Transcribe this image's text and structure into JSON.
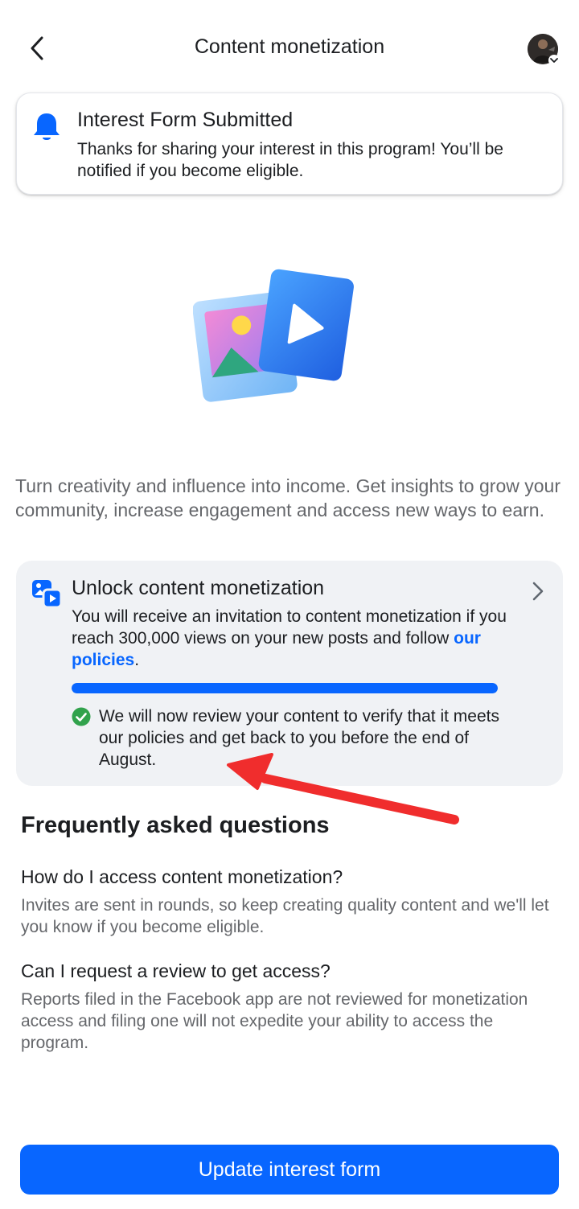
{
  "header": {
    "title": "Content monetization",
    "back_icon": "chevron-left-icon",
    "avatar_icon": "profile-avatar"
  },
  "notice": {
    "icon": "bell-icon",
    "title": "Interest Form Submitted",
    "body": "Thanks for sharing your interest in this program! You’ll be notified if you become eligible."
  },
  "hero": {
    "icon": "photo-video-illustration"
  },
  "intro": "Turn creativity and influence into income. Get insights to grow your community, increase engagement and access new ways to earn.",
  "card": {
    "icon": "photo-video-icon",
    "title": "Unlock content monetization",
    "body_before_link": "You will receive an invitation to content monetization if you reach 300,000 views on your new posts and follow ",
    "link_text": "our policies",
    "body_after_link": ".",
    "progress_percent": 100,
    "review_text": "We will now review your content to verify that it meets our policies and get back to you before the end of August.",
    "check_icon": "check-circle-icon",
    "chevron_icon": "chevron-right-icon"
  },
  "faq": {
    "heading": "Frequently asked questions",
    "items": [
      {
        "question": "How do I access content monetization?",
        "answer": "Invites are sent in rounds, so keep creating quality content and we'll let you know if you become eligible."
      },
      {
        "question": "Can I request a review to get access?",
        "answer": "Reports filed in the Facebook app are not reviewed for monetization access and filing one will not expedite your ability to access the program."
      }
    ]
  },
  "footer": {
    "update_button_label": "Update interest form"
  },
  "colors": {
    "accent": "#0866ff",
    "success": "#31a24c",
    "annotation_arrow": "#f02d2d",
    "card_bg": "#f0f2f5",
    "secondary_text": "#65676b"
  }
}
